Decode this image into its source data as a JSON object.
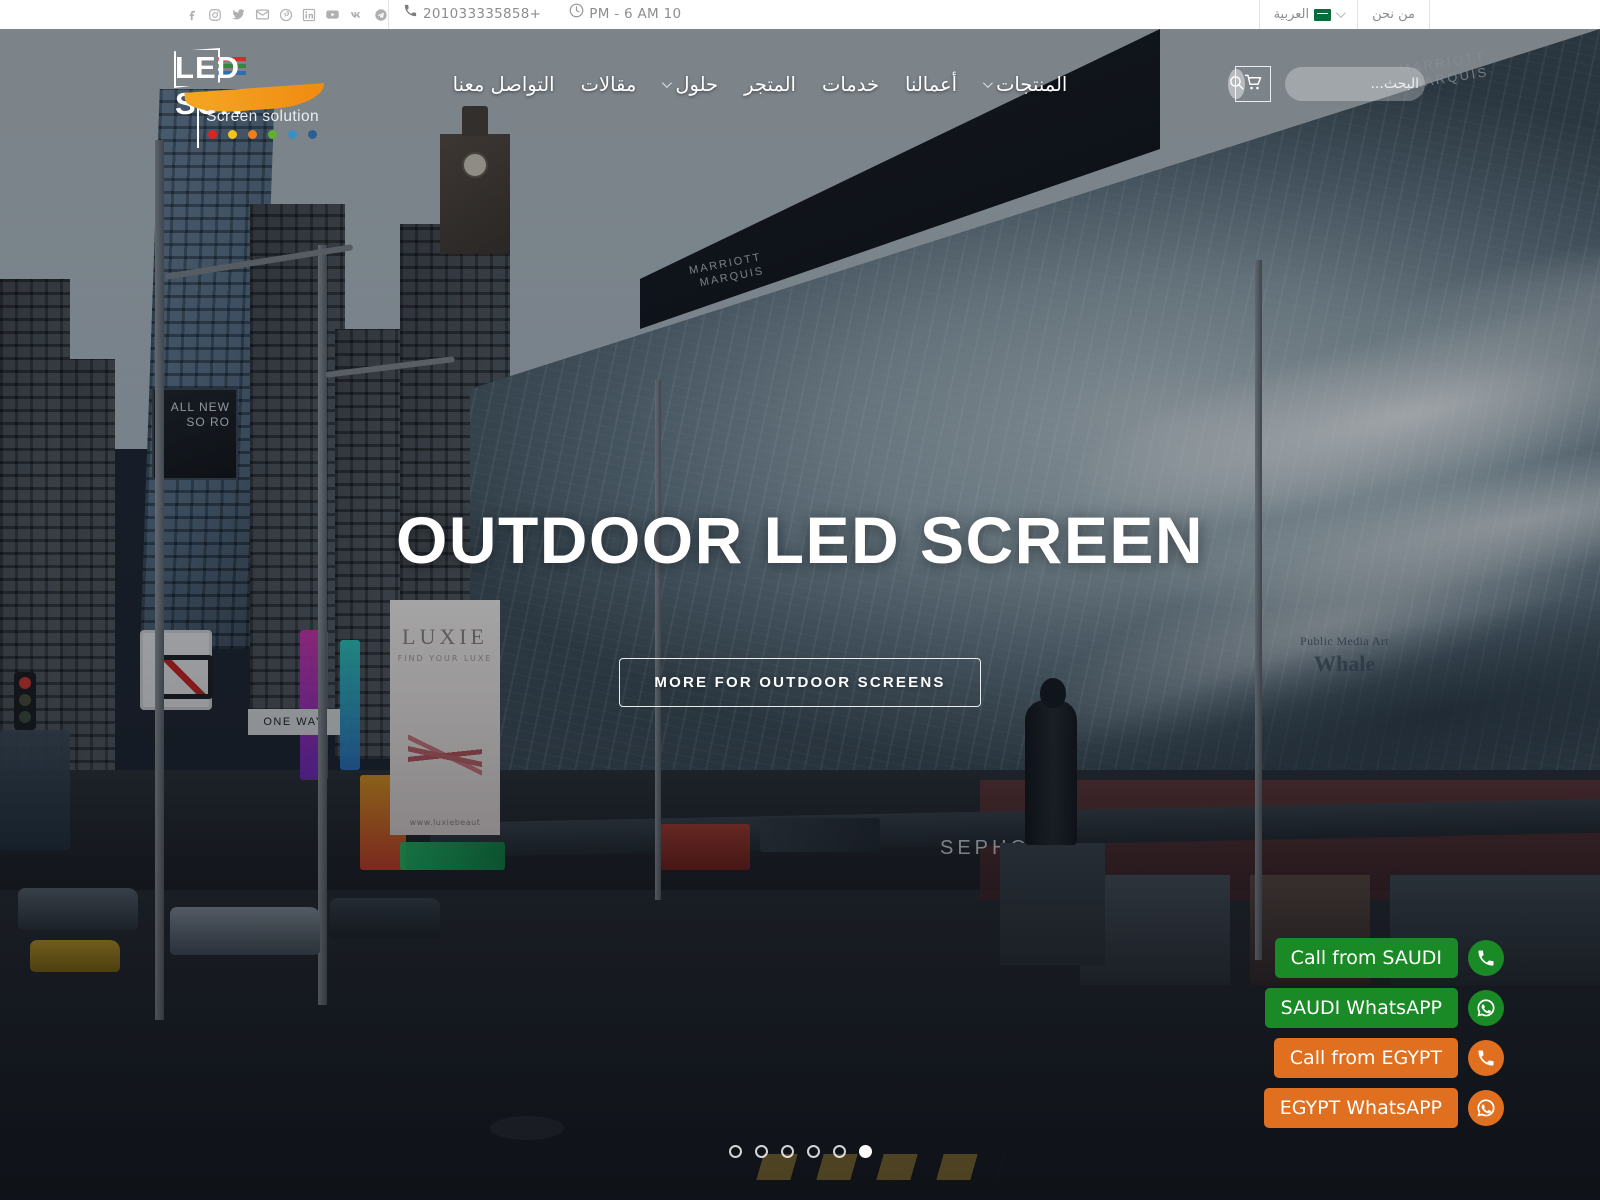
{
  "topbar": {
    "about_label": "من نحن",
    "language_label": "العربية",
    "language_flag": "saudi-flag-icon",
    "phone": "+201033335858",
    "hours": "10 PM - 6 AM",
    "socials": [
      {
        "name": "telegram-icon"
      },
      {
        "name": "vk-icon"
      },
      {
        "name": "youtube-icon"
      },
      {
        "name": "linkedin-icon"
      },
      {
        "name": "pinterest-icon"
      },
      {
        "name": "email-icon"
      },
      {
        "name": "twitter-icon"
      },
      {
        "name": "instagram-icon"
      },
      {
        "name": "facebook-icon"
      }
    ]
  },
  "logo": {
    "text": "LED SUN",
    "subtitle": "Screen solution",
    "dot_colors": [
      "#e0231f",
      "#f5c518",
      "#ef7f1a",
      "#5fb030",
      "#3a8fc4",
      "#2b5f93"
    ],
    "bar_colors": [
      "#d92b22",
      "#2d8a3e",
      "#2a6fb5"
    ]
  },
  "nav": {
    "items": [
      {
        "label": "المنتجات",
        "has_dropdown": true
      },
      {
        "label": "أعمالنا",
        "has_dropdown": false
      },
      {
        "label": "خدمات",
        "has_dropdown": false
      },
      {
        "label": "المتجر",
        "has_dropdown": false
      },
      {
        "label": "حلول",
        "has_dropdown": true
      },
      {
        "label": "مقالات",
        "has_dropdown": false
      },
      {
        "label": "التواصل معنا",
        "has_dropdown": false
      }
    ]
  },
  "search": {
    "placeholder": "البحث...",
    "value": "",
    "icon": "search-icon"
  },
  "cart": {
    "icon": "shopping-cart-icon"
  },
  "hero": {
    "title": "OUTDOOR LED SCREEN",
    "cta_label": "MORE FOR OUTDOOR SCREENS",
    "billboard_caption_small": "Public Media Art",
    "billboard_caption_big": "Whale",
    "marquis_text": "MARRIOTT\nMARQUIS",
    "marquis_text_2": "MARRIOTT\nMARQUIS",
    "store_sign": "SEPHORA",
    "street_sign_oneway": "ONE WAY",
    "billboard_left_text": "ALL NEW\nSO RO",
    "ad_title": "LUXIE",
    "ad_sub": "FIND YOUR LUXE",
    "ad_url": "www.luxiebeaut"
  },
  "slider": {
    "total": 6,
    "active_index": 5
  },
  "float_contacts": [
    {
      "label": "Call from SAUDI",
      "icon": "phone-icon",
      "color": "#1a8a27"
    },
    {
      "label": "SAUDI WhatsAPP",
      "icon": "whatsapp-icon",
      "color": "#1a8a27"
    },
    {
      "label": "Call from EGYPT",
      "icon": "phone-icon",
      "color": "#e0701f"
    },
    {
      "label": "EGYPT WhatsAPP",
      "icon": "whatsapp-icon",
      "color": "#e0701f"
    }
  ]
}
